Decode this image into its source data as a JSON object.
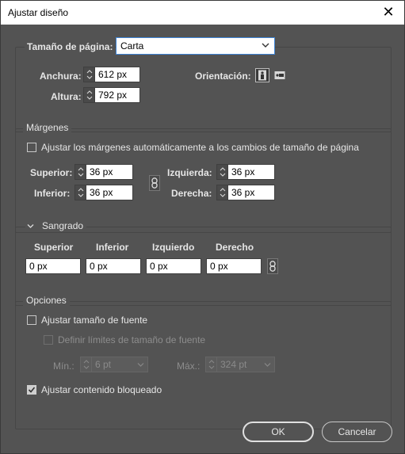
{
  "window": {
    "title": "Ajustar diseño"
  },
  "page_size": {
    "label": "Tamaño de página:",
    "value": "Carta"
  },
  "dimensions": {
    "width_label": "Anchura:",
    "width_value": "612 px",
    "height_label": "Altura:",
    "height_value": "792 px",
    "orientation_label": "Orientación:"
  },
  "margins": {
    "title": "Márgenes",
    "auto_adjust_label": "Ajustar los márgenes automáticamente a los cambios de tamaño de página",
    "top_label": "Superior:",
    "top_value": "36 px",
    "bottom_label": "Inferior:",
    "bottom_value": "36 px",
    "left_label": "Izquierda:",
    "left_value": "36 px",
    "right_label": "Derecha:",
    "right_value": "36 px"
  },
  "bleed": {
    "title": "Sangrado",
    "cols": [
      "Superior",
      "Inferior",
      "Izquierdo",
      "Derecho"
    ],
    "values": [
      "0 px",
      "0 px",
      "0 px",
      "0 px"
    ]
  },
  "options": {
    "title": "Opciones",
    "font_size_label": "Ajustar tamaño de fuente",
    "font_size_checked": false,
    "font_limits_label": "Definir límites de tamaño de fuente",
    "min_label": "Mín.:",
    "min_value": "6 pt",
    "max_label": "Máx.:",
    "max_value": "324 pt",
    "locked_label": "Ajustar contenido bloqueado",
    "locked_checked": true
  },
  "buttons": {
    "ok": "OK",
    "cancel": "Cancelar"
  }
}
